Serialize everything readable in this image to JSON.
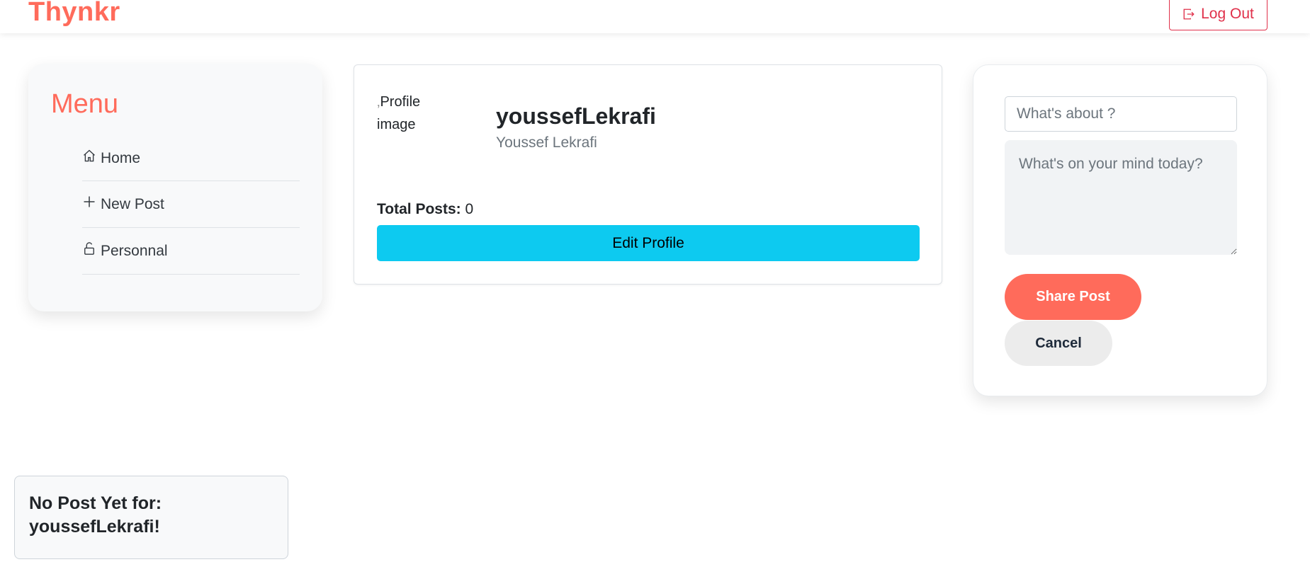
{
  "header": {
    "brand": "Thynkr",
    "logout_label": "Log Out",
    "accent_color": "#ff6b5b"
  },
  "menu": {
    "title": "Menu",
    "items": [
      {
        "label": "Home",
        "icon": "home-icon"
      },
      {
        "label": "New Post",
        "icon": "plus-icon"
      },
      {
        "label": "Personnal",
        "icon": "unlock-icon"
      }
    ]
  },
  "profile": {
    "image_alt_line1": "Profile",
    "image_alt_line2": "image",
    "username": "youssefLekrafi",
    "full_name": "Youssef Lekrafi",
    "total_posts_label": "Total Posts:",
    "total_posts_value": "0",
    "edit_label": "Edit Profile"
  },
  "post_form": {
    "title_placeholder": "What's about ?",
    "body_placeholder": "What's on your mind today?",
    "share_label": "Share Post",
    "cancel_label": "Cancel"
  },
  "empty_state": {
    "line1": "No Post Yet for:",
    "line2": "youssefLekrafi!"
  }
}
